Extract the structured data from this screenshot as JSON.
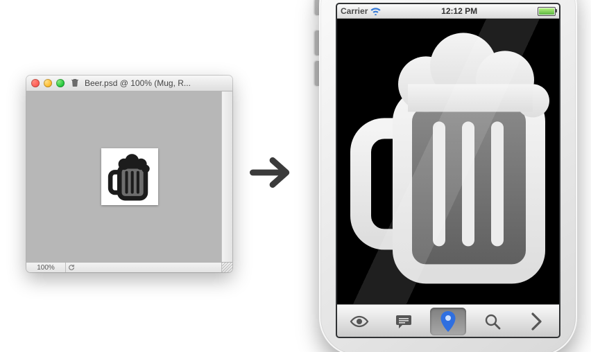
{
  "ps_window": {
    "title": "Beer.psd @ 100% (Mug, R...",
    "proxy_icon": "trash-icon",
    "zoom": "100%",
    "traffic_lights": {
      "close": "#ff5f57",
      "minimize": "#ffbd2e",
      "zoom": "#28c940"
    },
    "canvas_bg": "#b7b7b7"
  },
  "arrow": {
    "name": "right-arrow-icon"
  },
  "iphone": {
    "status_bar": {
      "carrier": "Carrier",
      "wifi_strength": 3,
      "time": "12:12 PM",
      "battery_pct": 100,
      "battery_color": "#5db642"
    },
    "content": {
      "image_name": "beer-mug-icon",
      "bg": "#000000"
    },
    "tabbar": {
      "items": [
        {
          "icon": "eye-icon",
          "active": false
        },
        {
          "icon": "comment-icon",
          "active": false
        },
        {
          "icon": "pin-icon",
          "active": true,
          "tint": "#2f6fe0"
        },
        {
          "icon": "search-icon",
          "active": false
        },
        {
          "icon": "chevron-right-icon",
          "active": false
        }
      ]
    }
  }
}
